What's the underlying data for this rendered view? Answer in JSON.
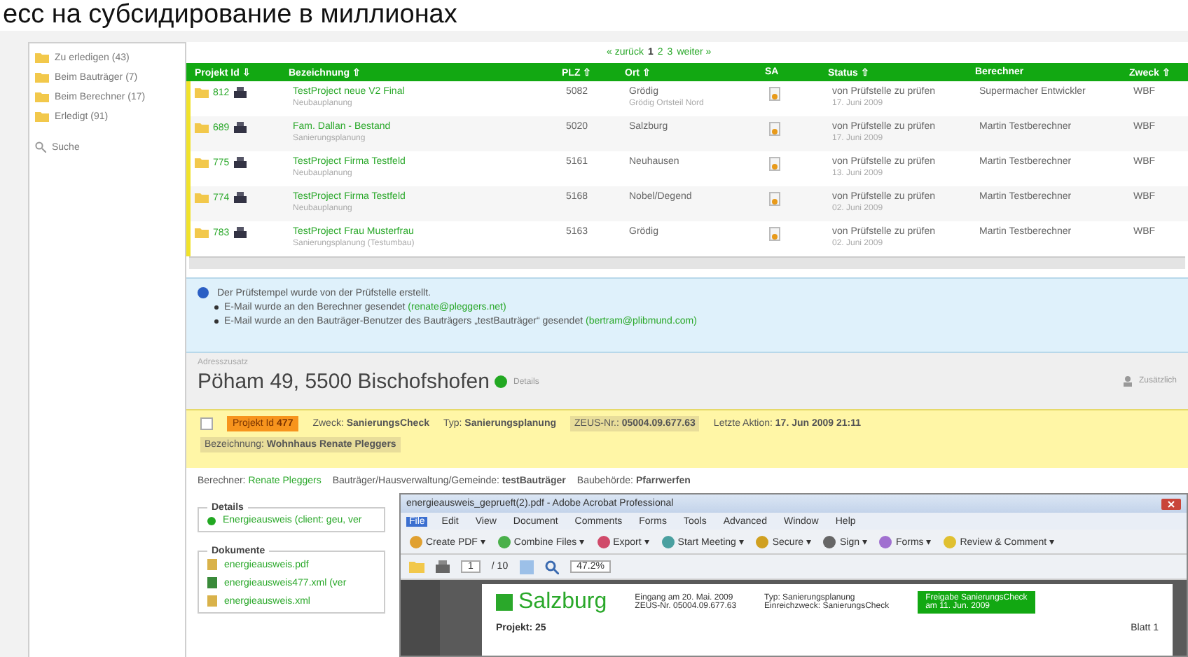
{
  "caption": "есс на субсидирование в миллионах",
  "sidebar": {
    "items": [
      {
        "label": "Zu erledigen (43)"
      },
      {
        "label": "Beim Bauträger (7)"
      },
      {
        "label": "Beim Berechner (17)"
      },
      {
        "label": "Erledigt (91)"
      }
    ],
    "search": "Suche"
  },
  "pagination": {
    "prev": "« zurück",
    "pages": [
      {
        "label": "1",
        "selected": true
      },
      {
        "label": "2",
        "selected": false
      },
      {
        "label": "3",
        "selected": false
      }
    ],
    "next": "weiter »"
  },
  "table": {
    "columns": [
      "Projekt Id ⇩",
      "Bezeichnung ⇧",
      "PLZ ⇧",
      "Ort ⇧",
      "SA",
      "Status ⇧",
      "Berechner",
      "Zweck ⇧"
    ],
    "rows": [
      {
        "id": "812",
        "title": "TestProject neue V2 Final",
        "subtitle": "Neubauplanung",
        "plz": "5082",
        "ort": "Grödig",
        "ort_note": "Grödig Ortsteil Nord",
        "status": "von Prüfstelle zu prüfen",
        "date": "17. Juni 2009",
        "berechner": "Supermacher Entwickler",
        "zweck": "WBF"
      },
      {
        "id": "689",
        "title": "Fam. Dallan - Bestand",
        "subtitle": "Sanierungsplanung",
        "plz": "5020",
        "ort": "Salzburg",
        "status": "von Prüfstelle zu prüfen",
        "date": "17. Juni 2009",
        "berechner": "Martin Testberechner",
        "zweck": "WBF"
      },
      {
        "id": "775",
        "title": "TestProject Firma Testfeld",
        "subtitle": "Neubauplanung",
        "plz": "5161",
        "ort": "Neuhausen",
        "status": "von Prüfstelle zu prüfen",
        "date": "13. Juni 2009",
        "berechner": "Martin Testberechner",
        "zweck": "WBF"
      },
      {
        "id": "774",
        "title": "TestProject Firma Testfeld",
        "subtitle": "Neubauplanung",
        "plz": "5168",
        "ort": "Nobel/Degend",
        "status": "von Prüfstelle zu prüfen",
        "date": "02. Juni 2009",
        "berechner": "Martin Testberechner",
        "zweck": "WBF"
      },
      {
        "id": "783",
        "title": "TestProject Frau Musterfrau",
        "subtitle": "Sanierungsplanung (Testumbau)",
        "plz": "5163",
        "ort": "Grödig",
        "status": "von Prüfstelle zu prüfen",
        "date": "02. Juni 2009",
        "berechner": "Martin Testberechner",
        "zweck": "WBF"
      }
    ]
  },
  "notice": {
    "title": "Der Prüfstempel wurde von der Prüfstelle erstellt.",
    "items": [
      {
        "text": "E-Mail wurde an den Berechner gesendet",
        "link": "(renate@pleggers.net)"
      },
      {
        "text": "E-Mail wurde an den Bauträger-Benutzer des Bauträgers „testBauträger“ gesendet",
        "link": "(bertram@plibmund.com)"
      }
    ]
  },
  "address": {
    "label": "Adresszusatz",
    "text": "Pöham 49, 5500 Bischofshofen",
    "badge": "Details",
    "action": "Zusätzlich"
  },
  "project": {
    "checked": false,
    "id_label": "Projekt Id",
    "id": "477",
    "fields": [
      {
        "label": "Zweck:",
        "value": "SanierungsCheck"
      },
      {
        "label": "Typ:",
        "value": "Sanierungsplanung"
      },
      {
        "label": "ZEUS-Nr.:",
        "value": "05004.09.677.63",
        "kind": "boxed"
      },
      {
        "label": "Letzte Aktion:",
        "value": "17. Jun 2009 21:11"
      }
    ],
    "name": {
      "label": "Bezeichnung:",
      "value": "Wohnhaus Renate Pleggers"
    }
  },
  "people": [
    {
      "label": "Berechner:",
      "value": "Renate Pleggers",
      "kind": "link"
    },
    {
      "label": "Bauträger/Hausverwaltung/Gemeinde:",
      "value": "testBauträger",
      "kind": "bold"
    },
    {
      "label": "Baubehörde:",
      "value": "Pfarrwerfen",
      "kind": "bold"
    }
  ],
  "details": {
    "legend": "Details",
    "item": "Energieausweis (client: geu, ver"
  },
  "documents": {
    "legend": "Dokumente",
    "files": [
      "energieausweis.pdf",
      "energieausweis477.xml (ver",
      "energieausweis.xml"
    ]
  },
  "acrobat": {
    "title": "energieausweis_geprueft(2).pdf - Adobe Acrobat Professional",
    "menu": [
      {
        "label": "File",
        "selected": true
      },
      {
        "label": "Edit",
        "selected": false
      },
      {
        "label": "View",
        "selected": false
      },
      {
        "label": "Document",
        "selected": false
      },
      {
        "label": "Comments",
        "selected": false
      },
      {
        "label": "Forms",
        "selected": false
      },
      {
        "label": "Tools",
        "selected": false
      },
      {
        "label": "Advanced",
        "selected": false
      },
      {
        "label": "Window",
        "selected": false
      },
      {
        "label": "Help",
        "selected": false
      }
    ],
    "tools": [
      "Create PDF ▾",
      "Combine Files ▾",
      "Export ▾",
      "Start Meeting ▾",
      "Secure ▾",
      "Sign ▾",
      "Forms ▾",
      "Review & Comment ▾"
    ],
    "page": "1",
    "pages": "/ 10",
    "zoom": "47.2%",
    "doc": {
      "logo": "Salzburg",
      "col1": [
        "Eingang am 20. Mai. 2009",
        "ZEUS-Nr. 05004.09.677.63"
      ],
      "col2": [
        "Typ: Sanierungsplanung",
        "Einreichzweck: SanierungsCheck"
      ],
      "stamp": [
        "Freigabe SanierungsCheck",
        "am 11. Jun. 2009"
      ],
      "project": "Projekt: 25",
      "sheet": "Blatt 1"
    }
  }
}
